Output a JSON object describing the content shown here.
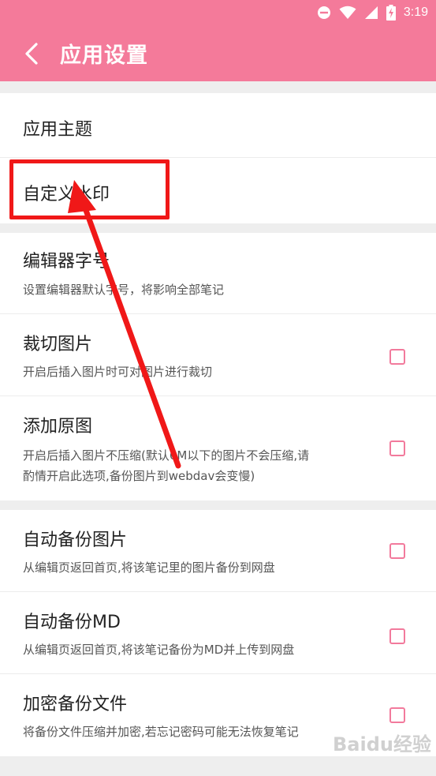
{
  "status_bar": {
    "time": "3:19",
    "icons": [
      "do-not-disturb-icon",
      "wifi-icon",
      "signal-icon",
      "battery-charging-icon"
    ]
  },
  "toolbar": {
    "back_icon": "chevron-left-icon",
    "title": "应用设置"
  },
  "sections": [
    {
      "rows": [
        {
          "title": "应用主题"
        },
        {
          "title": "自定义水印"
        }
      ]
    },
    {
      "rows": [
        {
          "title": "编辑器字号",
          "subtitle": "设置编辑器默认字号，将影响全部笔记"
        },
        {
          "title": "裁切图片",
          "subtitle": "开启后插入图片时可对图片进行裁切",
          "checked": false
        },
        {
          "title": "添加原图",
          "subtitle_lines": [
            "开启后插入图片不压缩(默认6M以下的图片不会压缩,请",
            "酌情开启此选项,备份图片到webdav会变慢)"
          ],
          "checked": false
        }
      ]
    },
    {
      "rows": [
        {
          "title": "自动备份图片",
          "subtitle": "从编辑页返回首页,将该笔记里的图片备份到网盘",
          "checked": false
        },
        {
          "title": "自动备份MD",
          "subtitle": "从编辑页返回首页,将该笔记备份为MD并上传到网盘",
          "checked": false
        },
        {
          "title": "加密备份文件",
          "subtitle": "将备份文件压缩并加密,若忘记密码可能无法恢复笔记",
          "checked": false
        }
      ]
    }
  ],
  "annotation": {
    "color": "#f01818"
  },
  "watermark": "Baidu经验",
  "colors": {
    "header": "#f47a9a",
    "checkbox": "#f27a9c",
    "background": "#eeeeee"
  }
}
